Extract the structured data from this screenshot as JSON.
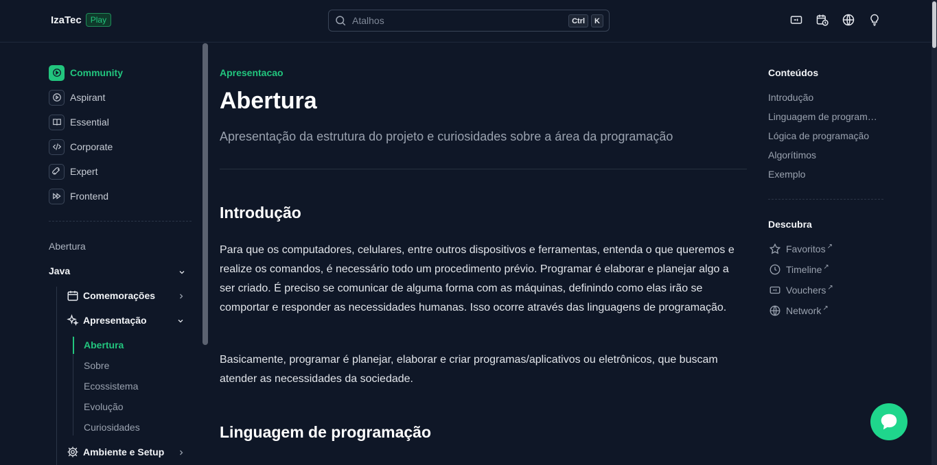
{
  "header": {
    "brand": "IzaTec",
    "badge": "Play",
    "search_placeholder": "Atalhos",
    "kbd": [
      "Ctrl",
      "K"
    ],
    "icons": [
      "ticket-icon",
      "calendar-clock-icon",
      "globe-icon",
      "lightbulb-icon"
    ]
  },
  "sidebar": {
    "tracks": [
      {
        "label": "Community",
        "icon": "play-circle-icon",
        "active": true
      },
      {
        "label": "Aspirant",
        "icon": "play-circle-icon",
        "active": false
      },
      {
        "label": "Essential",
        "icon": "book-open-icon",
        "active": false
      },
      {
        "label": "Corporate",
        "icon": "code-icon",
        "active": false
      },
      {
        "label": "Expert",
        "icon": "rocket-icon",
        "active": false
      },
      {
        "label": "Frontend",
        "icon": "fast-forward-icon",
        "active": false
      }
    ],
    "section_abertura": "Abertura",
    "section_java": "Java",
    "groups": [
      {
        "label": "Comemorações",
        "icon": "calendar-icon"
      },
      {
        "label": "Apresentação",
        "icon": "sparkles-icon"
      },
      {
        "label": "Ambiente e Setup",
        "icon": "gear-icon"
      }
    ],
    "leaves": [
      "Abertura",
      "Sobre",
      "Ecossistema",
      "Evolução",
      "Curiosidades"
    ]
  },
  "main": {
    "eyebrow": "Apresentacao",
    "title": "Abertura",
    "lead": "Apresentação da estrutura do projeto e curiosidades sobre a área da programação",
    "section1_title": "Introdução",
    "para1": "Para que os computadores, celulares, entre outros dispositivos e ferramentas, entenda o que queremos e realize os comandos, é necessário todo um procedimento prévio. Programar é elaborar e planejar algo a ser criado. É preciso se comunicar de alguma forma com as máquinas, definindo como elas irão se comportar e responder as necessidades humanas. Isso ocorre através das linguagens de programação.",
    "para2": "Basicamente, programar é planejar, elaborar e criar programas/aplicativos ou eletrônicos, que buscam atender as necessidades da sociedade.",
    "section2_title": "Linguagem de programação"
  },
  "toc": {
    "title": "Conteúdos",
    "links": [
      "Introdução",
      "Linguagem de programação",
      "Lógica de programação",
      "Algorítimos",
      "Exemplo"
    ],
    "discover_title": "Descubra",
    "discover": [
      "Favoritos",
      "Timeline",
      "Vouchers",
      "Network"
    ]
  },
  "colors": {
    "accent": "#22c57e",
    "background": "#0f1727"
  }
}
